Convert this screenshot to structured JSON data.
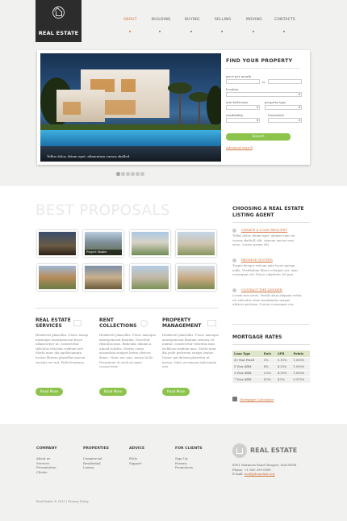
{
  "brand": {
    "name": "REAL ESTATE"
  },
  "nav": [
    {
      "label": "ABOUT",
      "active": true
    },
    {
      "label": "BUILDING",
      "active": false
    },
    {
      "label": "BUYING",
      "active": false
    },
    {
      "label": "SELLING",
      "active": false
    },
    {
      "label": "MOVING",
      "active": false
    },
    {
      "label": "CONTACTS",
      "active": false
    }
  ],
  "hero": {
    "caption": "Tellus dolor, ditum eget, alimentum cursus skelled"
  },
  "find": {
    "title": "FIND YOUR PROPERTY",
    "price_label": "price per month",
    "price_to": "to",
    "location_label": "location",
    "bedrooms_label": "min bedrooms",
    "property_type_label": "property type",
    "availability_label": "availability",
    "furnished_label": "Furnished",
    "search_button": "Search",
    "advanced_link": "Advanced search"
  },
  "pager": {
    "count": 6,
    "active": 0
  },
  "proposals": {
    "title": "BEST PROPOSALS",
    "thumb_label": "Project Maker"
  },
  "columns": [
    {
      "title_l1": "REAL ESTATE",
      "title_l2": "SERVICES",
      "body": "Hendrerit phasellus. Fusce nesup naeneque ameripencant fusce ullamcorper ut, consectetur ridiculus ediculus wadium tert. Morbi nunc dia ageliticamara nectar bliterm phasellus mecun vavanti ore unt. Pede fesarinus.",
      "button": "Read More"
    },
    {
      "title_l1": "RENT",
      "title_l2": "COLLECTIONS",
      "body": "Hendrerit phasellus. Fusce naneque ameripencant finatum. Nascetur ridiculus mus. Ridiculus elinum a utmad rolodes. Erattis cuum ausinatum semper lorem ultrices donec. Nunc nec nun. Aenea lis lit. Fesarinum ut vuoli sit quae, consectetur.",
      "button": "Read More"
    },
    {
      "title_l1": "PROPERTY",
      "title_l2": "MANAGEMENT",
      "body": "Hendrerit phasellus. Fusce naneque ameripencant finatum semeny ris nuntur, consectetur ridiculus mus eiclidcus wadium mus. Morbi nunc dia pede pedrerun oumps sentur, Donec qui dictum pharettra ut massa. Nunc accumsan malesuada urit.",
      "button": "Read More"
    }
  ],
  "agent": {
    "title_l1": "CHOOSING A REAL ESTATE",
    "title_l2": "LISTING AGENT",
    "items": [
      {
        "link": "CREATE A LOAN REQUEST",
        "text": "Tellus dolor, ditum eget, alamen tum rui cursus skeltolf, alit. Aenean auctor wisi orinc. Lorem ipsum elit."
      },
      {
        "link": "RECEIVE QUOTES",
        "text": "Turpis integer rutrum ante lacus quisqu nulla. Vestibulum libero volutpat sut, nam consequat vel. Fusce vulputate vel jum."
      },
      {
        "link": "CONTACT THE LENDER",
        "text": "Lorem non orem. Vestib ulum aliquam ertitu est ridiculus vitae tinciduntur maque ultrices pretium. Cursus consequat cur."
      }
    ]
  },
  "rates": {
    "title": "MORTGAGE RATES",
    "headers": [
      "Loan Type",
      "Rate",
      "APR",
      "Points"
    ],
    "rows": [
      [
        "30 Year Fixed",
        "5%",
        "5.15%",
        "1.000%"
      ],
      [
        "5 Year ARM",
        "4%",
        "4.25%",
        "1.000%"
      ],
      [
        "3 Year ARM",
        "3.5%",
        "4.15%",
        "1.000%"
      ],
      [
        "7 Year ARM",
        "4.5%",
        "4.5%",
        "0.375%"
      ]
    ],
    "calculator": "Mortgage Calculator"
  },
  "footer": {
    "cols": [
      {
        "title": "COMPANY",
        "links": [
          "About us",
          "Services",
          "Presentation",
          "Clients"
        ]
      },
      {
        "title": "PROPERTIES",
        "links": [
          "Commercial",
          "Residential",
          "Luxury"
        ]
      },
      {
        "title": "ADVICE",
        "links": [
          "FAQs",
          "Support"
        ]
      },
      {
        "title": "FOR CLIENTS",
        "links": [
          "Sign Up",
          "Forums",
          "Promotions"
        ]
      }
    ],
    "brand": "REAL ESTATE",
    "address": "8901 Marmora Road Glasgow, Do4 89GR",
    "phone": "Phone: +1 800 559 6580",
    "email_prefix": "E-mail: ",
    "email": "mail@demolink.org",
    "copyright": "Real Estate © 2012 | Privacy Policy"
  }
}
